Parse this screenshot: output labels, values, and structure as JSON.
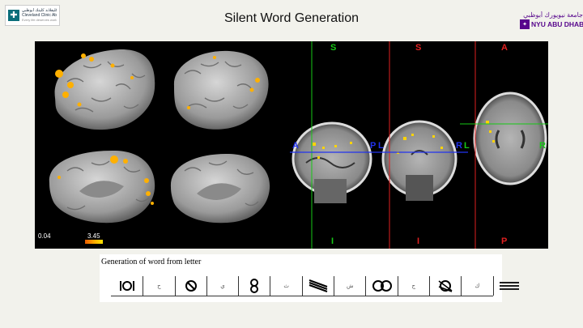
{
  "header": {
    "title": "Silent Word Generation",
    "logo_left": {
      "arabic": "كليفلاند كلينك أبوظبي",
      "english": "Cleveland Clinic Abu Dhabi",
      "tagline": "Every life deserves world class care"
    },
    "logo_right": {
      "arabic": "جامعة نيويورك أبوظبي",
      "english": "NYU ABU DHABI"
    }
  },
  "figure": {
    "colorbar": {
      "min": "0.04",
      "max": "3.45"
    },
    "orientation_labels": {
      "superior": "S",
      "inferior": "I",
      "anterior": "A",
      "posterior": "P",
      "left": "L",
      "right": "R"
    },
    "colors": {
      "green": "#16c916",
      "red": "#e02020",
      "blue": "#2233ee",
      "activation": "#ffb000"
    }
  },
  "stimulus": {
    "title": "Generation of word from letter",
    "letters": [
      "ح",
      "ي",
      "ث",
      "ش",
      "ج",
      "ك"
    ],
    "symbol_icons": [
      "circle-bars-icon",
      "slashed-circle-icon",
      "figure-eight-icon",
      "diagonal-lines-icon",
      "double-circle-icon",
      "crossed-circle-icon",
      "triple-lines-icon"
    ]
  }
}
